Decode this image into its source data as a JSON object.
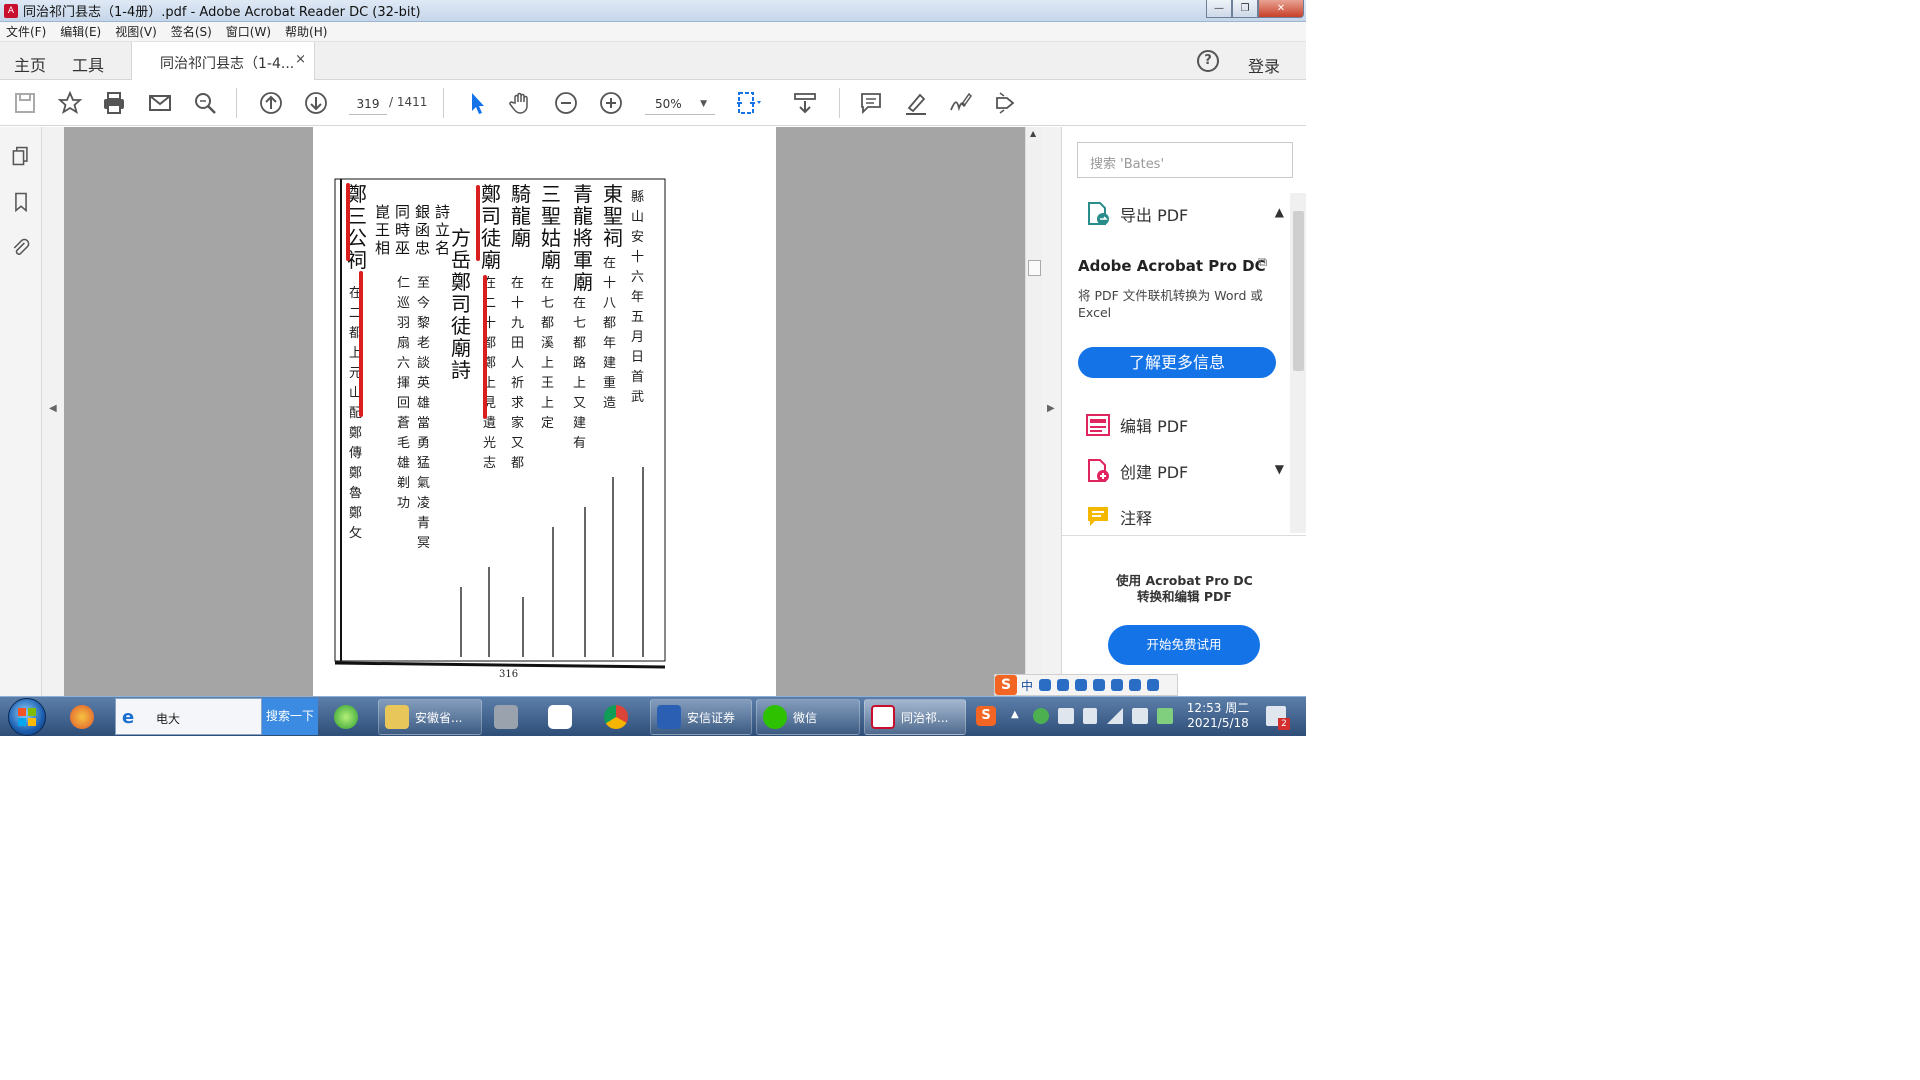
{
  "window": {
    "title": "同治祁门县志（1-4册）.pdf - Adobe Acrobat Reader DC (32-bit)",
    "controls": [
      "minimize",
      "restore",
      "close"
    ]
  },
  "menubar": {
    "items": [
      "文件(F)",
      "编辑(E)",
      "视图(V)",
      "签名(S)",
      "窗口(W)",
      "帮助(H)"
    ]
  },
  "tabs": {
    "home": "主页",
    "tools": "工具",
    "document": "同治祁门县志（1-4...",
    "close": "×",
    "help": "?",
    "signin": "登录"
  },
  "toolbar": {
    "icons": [
      "save-icon",
      "bookmark-star-icon",
      "print-icon",
      "email-icon",
      "search-zoom-icon",
      "page-up-icon",
      "page-down-icon",
      "select-cursor-icon",
      "hand-icon",
      "zoom-out-icon",
      "zoom-in-icon",
      "fit-page-icon",
      "scroll-mode-icon",
      "comment-icon",
      "highlight-icon",
      "sign-icon",
      "share-icon"
    ],
    "current_page": "319",
    "total_pages": "/ 1411",
    "zoom": "50%"
  },
  "document_page": {
    "page_number": "316"
  },
  "right_panel": {
    "search_placeholder": "搜索 'Bates'",
    "export_pdf": "导出 PDF",
    "promo_title": "Adobe Acrobat Pro DC",
    "promo_desc": "将 PDF 文件联机转换为 Word 或 Excel",
    "promo_button": "了解更多信息",
    "edit_pdf": "编辑 PDF",
    "create_pdf": "创建 PDF",
    "comment": "注释",
    "trial_line1": "使用 Acrobat Pro DC",
    "trial_line2": "转换和编辑 PDF",
    "trial_button": "开始免费试用"
  },
  "taskbar": {
    "ie_address": "电大",
    "search_button": "搜索一下",
    "folder_label": "安徽省...",
    "securities_label": "安信证券",
    "wechat_label": "微信",
    "acrobat_label": "同治祁...",
    "clock_time": "12:53 周二",
    "clock_date": "2021/5/18",
    "notification_badge": "2",
    "ime_label": "中"
  }
}
